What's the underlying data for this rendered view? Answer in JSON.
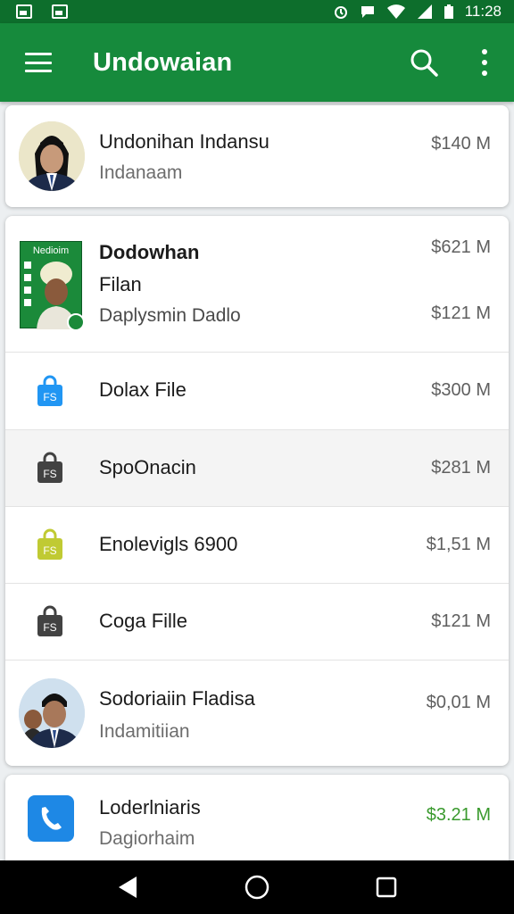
{
  "status_bar": {
    "time": "11:28"
  },
  "app_bar": {
    "title": "Undowaian"
  },
  "items": [
    {
      "title": "Undonihan Indansu",
      "subtitle": "Indanaam",
      "price": "$140 M"
    },
    {
      "title": "Dodowhan",
      "title2": "Filan",
      "subtitle": "Daplysmin Dadlo",
      "price": "$621 M",
      "price2": "$121 M",
      "thumb_label": "Nedioim"
    },
    {
      "title": "Dolax File",
      "price": "$300 M",
      "icon_color": "#2196f3",
      "icon_label": "FS"
    },
    {
      "title": "SpoOnacin",
      "price": "$281 M",
      "icon_color": "#424242",
      "icon_label": "FS"
    },
    {
      "title": "Enolevigls 6900",
      "price": "$1,51 M",
      "icon_color": "#c0ca33",
      "icon_label": "FS"
    },
    {
      "title": "Coga Fille",
      "price": "$121 M",
      "icon_color": "#424242",
      "icon_label": "FS"
    },
    {
      "title": "Sodoriaiin Fladisa",
      "subtitle": "Indamitiian",
      "price": "$0,01 M"
    },
    {
      "title": "Loderlniaris",
      "subtitle": "Dagiorhaim",
      "price": "$3.21 M",
      "icon_color": "#1e88e5"
    }
  ],
  "colors": {
    "primary": "#168a3c",
    "status_bar": "#0d6e2c",
    "price_positive": "#3a9a2e"
  }
}
